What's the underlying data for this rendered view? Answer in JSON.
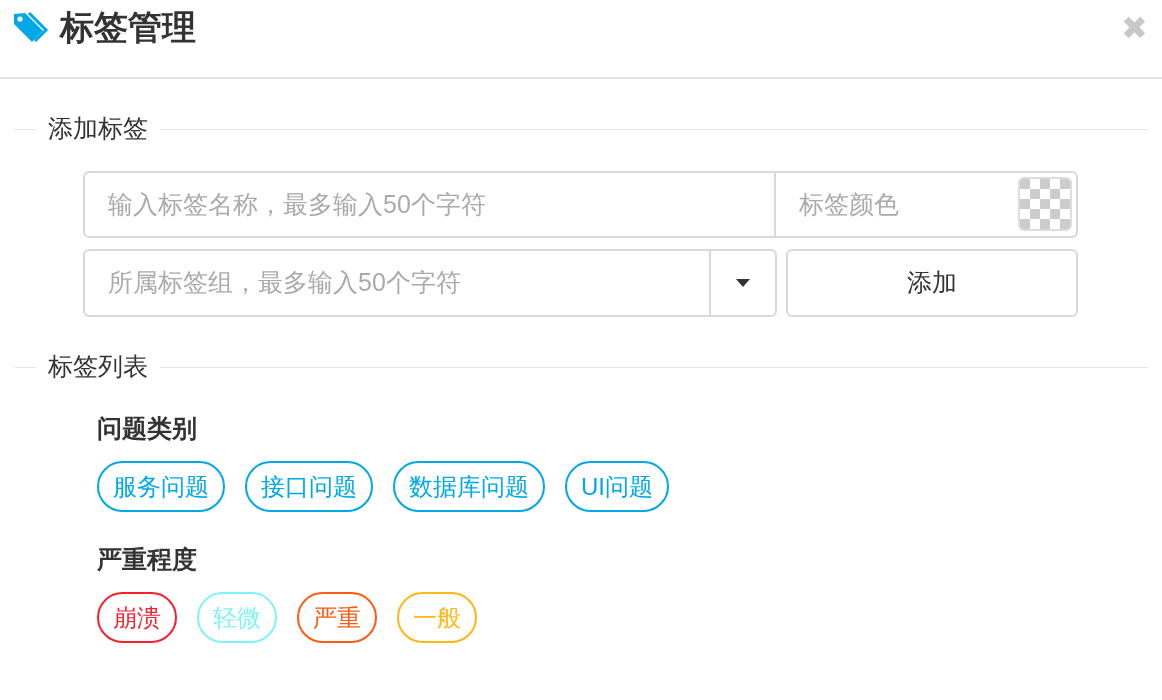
{
  "window": {
    "title": "标签管理",
    "close": "✖"
  },
  "add_section": {
    "legend": "添加标签",
    "name_placeholder": "输入标签名称，最多输入50个字符",
    "color_placeholder": "标签颜色",
    "group_placeholder": "所属标签组，最多输入50个字符",
    "add_button": "添加"
  },
  "list_section": {
    "legend": "标签列表",
    "groups": [
      {
        "title": "问题类别",
        "tags": [
          {
            "label": "服务问题",
            "color": "#00a8e8"
          },
          {
            "label": "接口问题",
            "color": "#00a8e8"
          },
          {
            "label": "数据库问题",
            "color": "#00a8e8"
          },
          {
            "label": "UI问题",
            "color": "#00a8e8"
          }
        ]
      },
      {
        "title": "严重程度",
        "tags": [
          {
            "label": "崩溃",
            "color": "#f5222d"
          },
          {
            "label": "轻微",
            "color": "#7ff3f7"
          },
          {
            "label": "严重",
            "color": "#ff5b14"
          },
          {
            "label": "一般",
            "color": "#ffb714"
          }
        ]
      }
    ]
  }
}
